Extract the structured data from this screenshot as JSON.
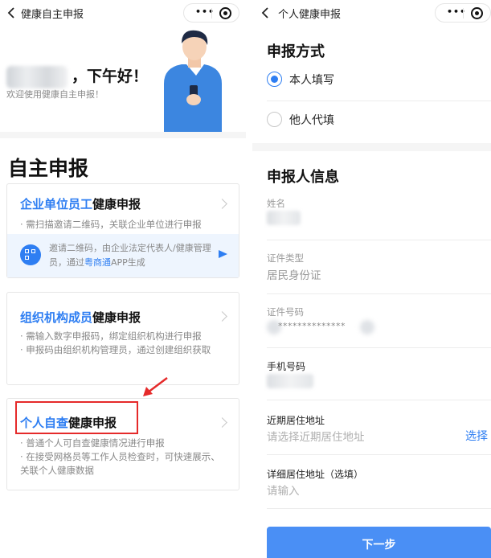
{
  "left": {
    "nav_title": "健康自主申报",
    "greeting": "，下午好！",
    "welcome": "欢迎使用健康自主申报！",
    "section_title": "自主申报",
    "cards": [
      {
        "title_accent": "企业单位员工",
        "title_rest": "健康申报",
        "desc": "· 需扫描邀请二维码，关联企业单位进行申报",
        "tip_pre": "邀请二维码，由企业法定代表人/健康管理员，通过",
        "tip_link": "粤商通",
        "tip_post": "APP生成"
      },
      {
        "title_accent": "组织机构成员",
        "title_rest": "健康申报",
        "desc": "· 需输入数字申报码，绑定组织机构进行申报\n· 申报码由组织机构管理员，通过创建组织获取"
      },
      {
        "title_accent": "个人自查",
        "title_rest": "健康申报",
        "desc": "· 普通个人可自查健康情况进行申报\n· 在接受网格员等工作人员检查时，可快速展示、关联个人健康数据"
      }
    ]
  },
  "right": {
    "nav_title": "个人健康申报",
    "method_heading": "申报方式",
    "options": [
      {
        "label": "本人填写",
        "checked": true
      },
      {
        "label": "他人代填",
        "checked": false
      }
    ],
    "info_heading": "申报人信息",
    "fields": {
      "name_label": "姓名",
      "id_type_label": "证件类型",
      "id_type_value": "居民身份证",
      "id_number_label": "证件号码",
      "id_number_masked": "**************",
      "phone_label": "手机号码",
      "address_label": "近期居住地址",
      "address_placeholder": "请选择近期居住地址",
      "address_action": "选择",
      "detail_label": "详细居住地址（选填）",
      "detail_placeholder": "请输入"
    },
    "next_button": "下一步"
  },
  "colors": {
    "accent": "#2e7ef2",
    "highlight": "#e52a2a",
    "button": "#4a8ff5"
  },
  "icons": [
    "back-arrow-icon",
    "more-dots-icon",
    "target-icon",
    "qr-code-icon",
    "send-icon",
    "chevron-right-icon",
    "person-illustration"
  ]
}
